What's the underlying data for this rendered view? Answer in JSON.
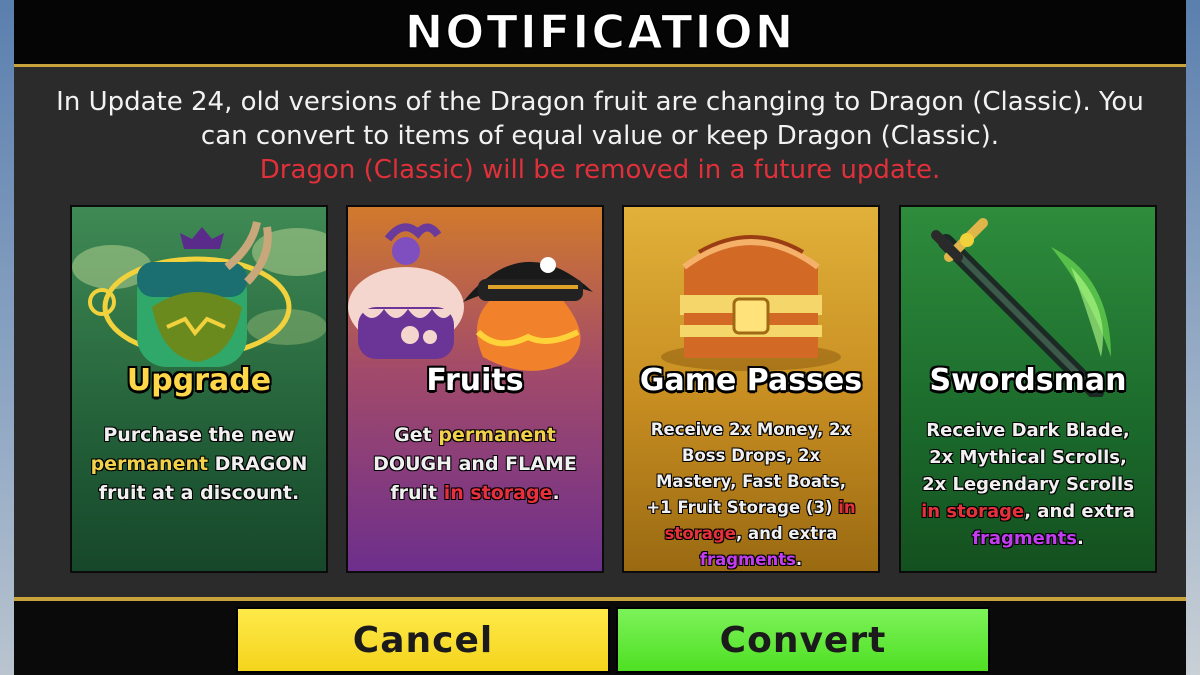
{
  "dialog": {
    "title": "NOTIFICATION",
    "message": "In Update 24, old versions of the Dragon fruit are changing to Dragon (Classic). You can convert to items of equal value or keep Dragon (Classic).",
    "warning": "Dragon (Classic) will be removed in a future update."
  },
  "cards": [
    {
      "title": "Upgrade",
      "desc_1": "Purchase the new",
      "desc_2_hl": "permanent",
      "desc_2": " DRAGON",
      "desc_3": "fruit at a discount."
    },
    {
      "title": "Fruits",
      "desc_1": "Get ",
      "desc_1_hl": "permanent",
      "desc_2": "DOUGH and FLAME",
      "desc_3": "fruit ",
      "desc_3_hl": "in storage",
      "desc_3_end": "."
    },
    {
      "title": "Game Passes",
      "desc_1": "Receive 2x Money, 2x",
      "desc_2": "Boss Drops, 2x",
      "desc_3": "Mastery, Fast Boats,",
      "desc_4": "+1 Fruit Storage (3) ",
      "desc_4_hl": "in",
      "desc_5_hl": "storage",
      "desc_5": ", and extra",
      "desc_6_hl": "fragments",
      "desc_6": "."
    },
    {
      "title": "Swordsman",
      "desc_1": "Receive Dark Blade,",
      "desc_2": "2x Mythical Scrolls,",
      "desc_3": "2x Legendary Scrolls",
      "desc_4_hl": "in storage",
      "desc_4": ", and extra",
      "desc_5_hl": "fragments",
      "desc_5": "."
    }
  ],
  "buttons": {
    "cancel": "Cancel",
    "convert": "Convert"
  },
  "icons": {
    "upgrade": "dragon-fruit-icon",
    "fruits": "dough-flame-fruits-icon",
    "passes": "treasure-chest-icon",
    "swords": "dark-blade-sword-icon"
  },
  "colors": {
    "accent_gold": "#c8a23a",
    "warning_red": "#e0303a",
    "cancel_yellow": "#f4d41c",
    "convert_green": "#4fe023"
  }
}
